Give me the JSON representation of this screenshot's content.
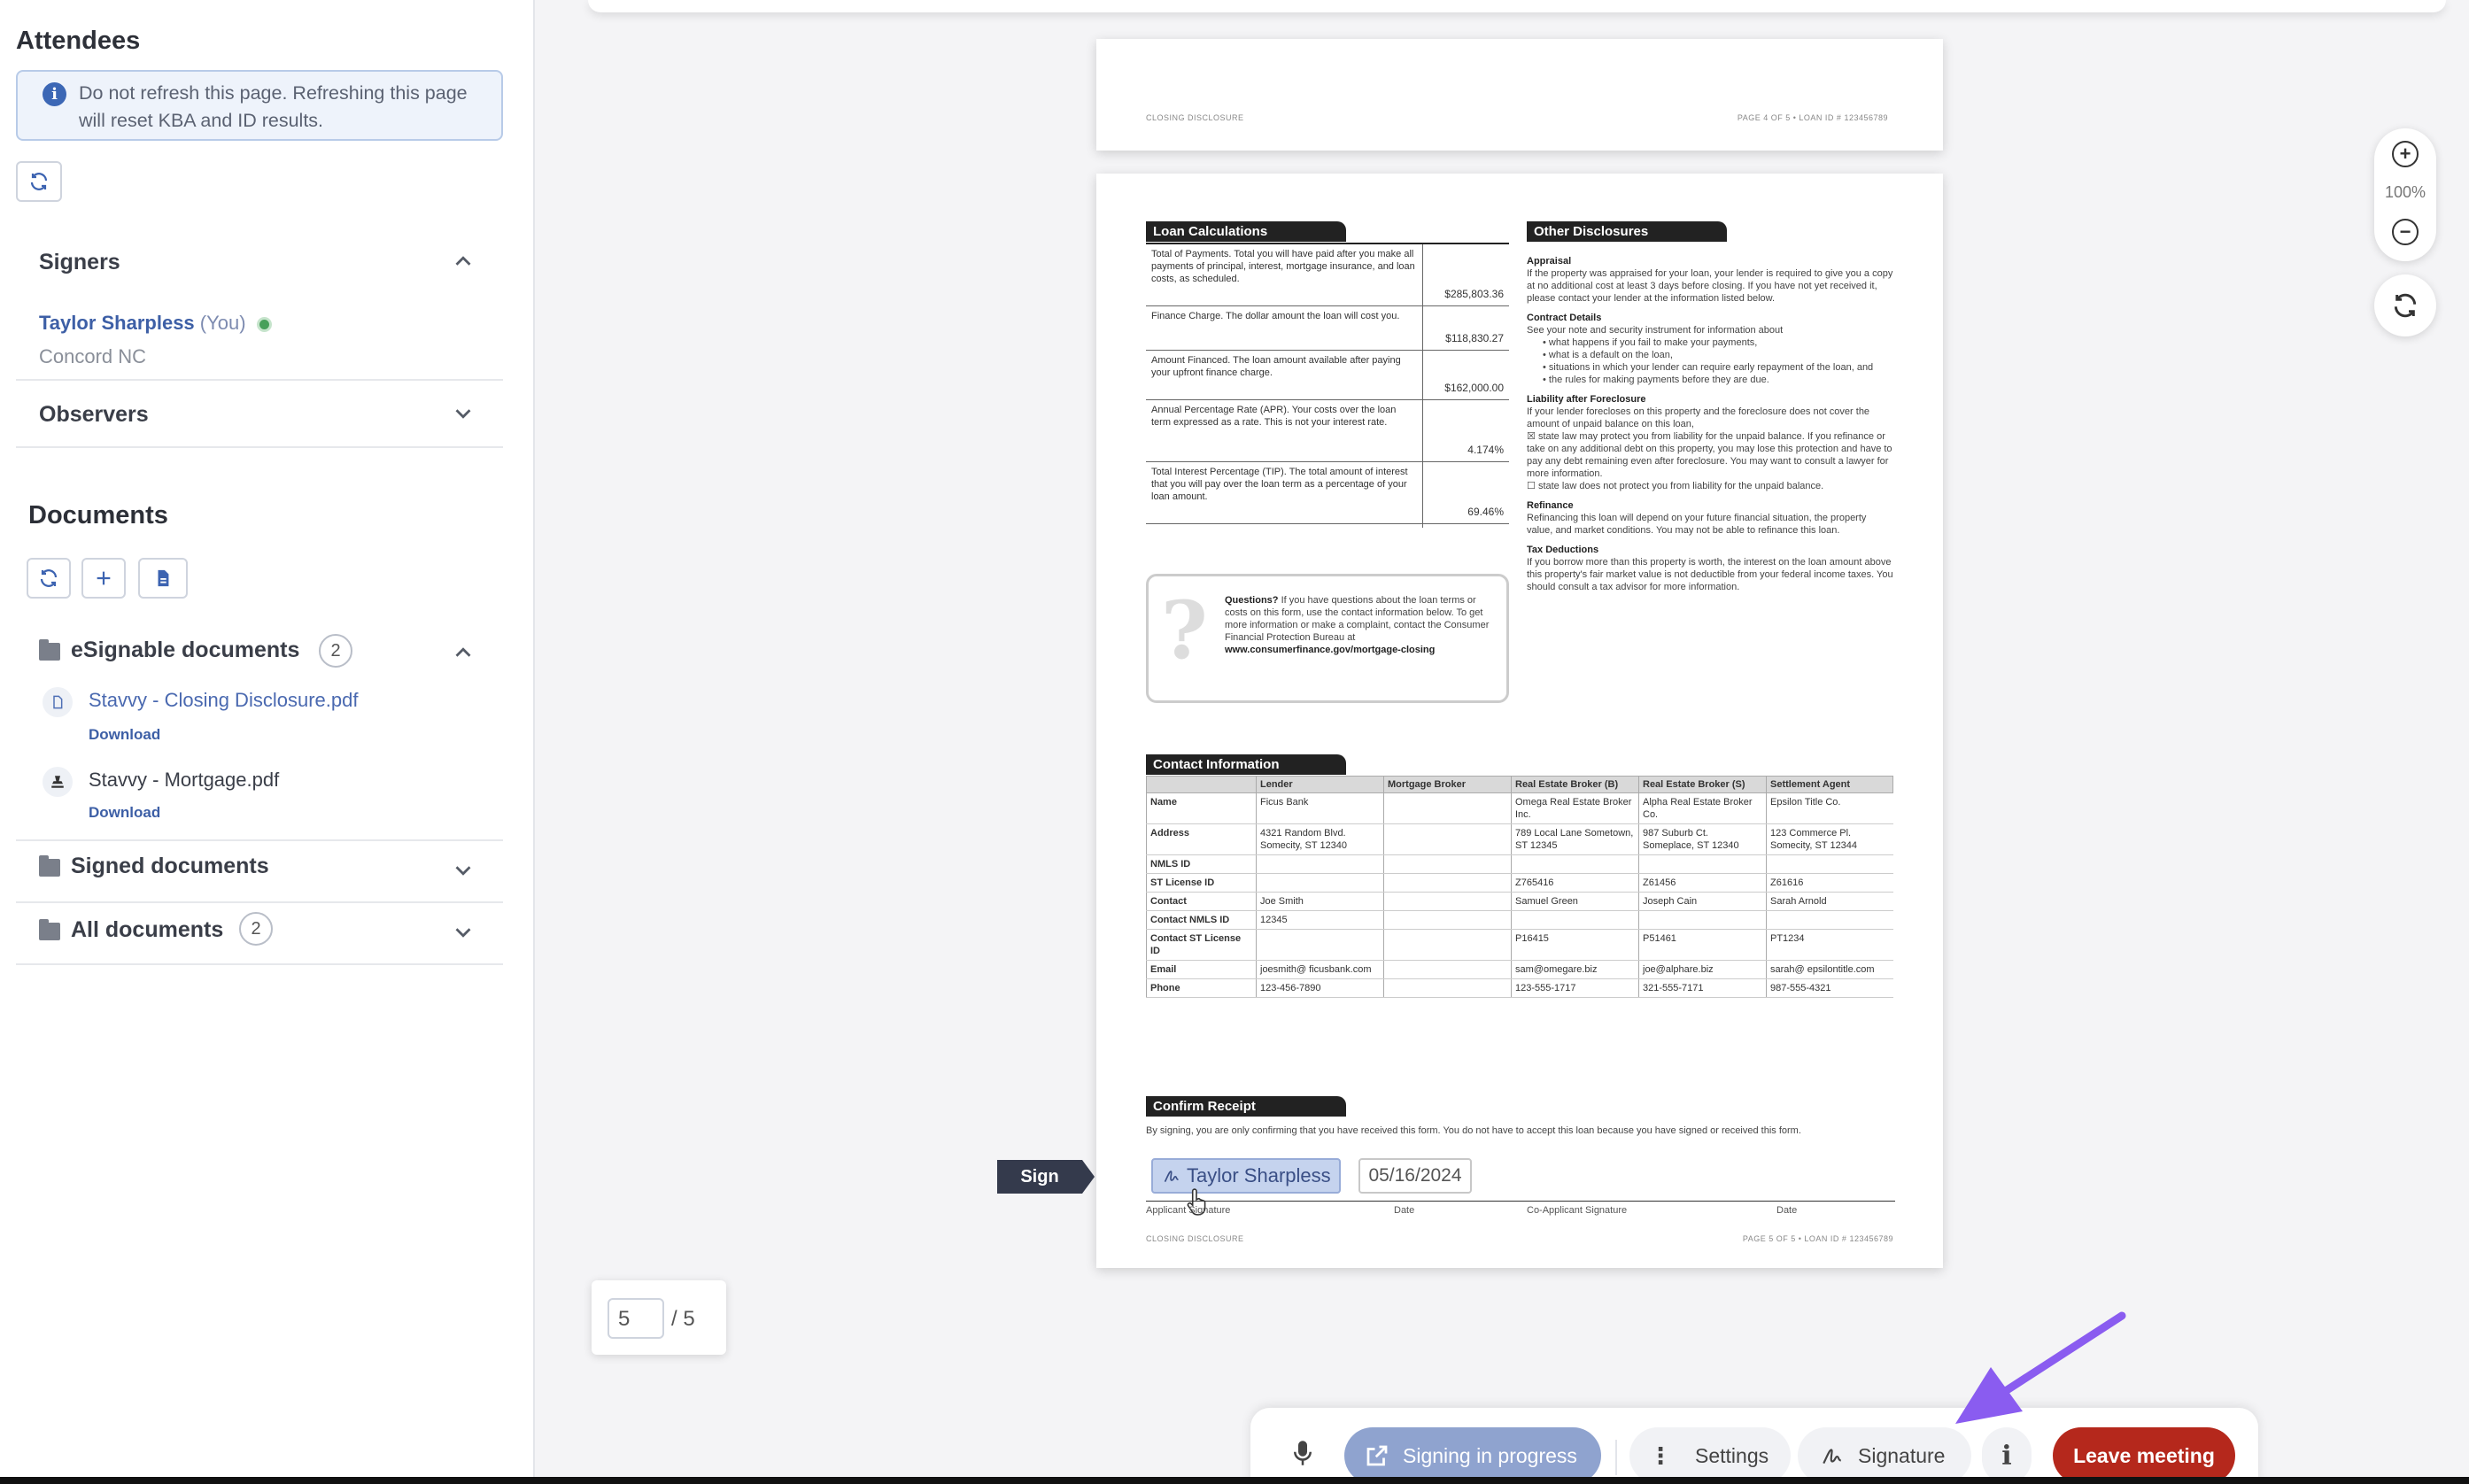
{
  "sidebar": {
    "attendees_title": "Attendees",
    "notice": "Do not refresh this page. Refreshing this page will reset KBA and ID results.",
    "signers": {
      "title": "Signers",
      "name": "Taylor Sharpless",
      "you_tag": "(You)",
      "location": "Concord NC"
    },
    "observers_title": "Observers",
    "documents_title": "Documents",
    "folders": {
      "esignable": {
        "label": "eSignable documents",
        "count": "2"
      },
      "signed": {
        "label": "Signed documents"
      },
      "all": {
        "label": "All documents",
        "count": "2"
      }
    },
    "docs": [
      {
        "name": "Stavvy - Closing Disclosure.pdf",
        "download": "Download"
      },
      {
        "name": "Stavvy - Mortgage.pdf",
        "download": "Download"
      }
    ]
  },
  "viewer": {
    "prev_page_footer_left": "CLOSING DISCLOSURE",
    "prev_page_footer_right": "PAGE 4 OF 5 • LOAN ID # 123456789",
    "page_footer_left": "CLOSING DISCLOSURE",
    "page_footer_right": "PAGE 5 OF 5 • LOAN ID # 123456789",
    "loan_calc_title": "Loan Calculations",
    "loan_calcs": [
      {
        "label": "Total of Payments. Total you will have paid after you make all payments of principal, interest, mortgage insurance, and loan costs, as scheduled.",
        "value": "$285,803.36"
      },
      {
        "label": "Finance Charge. The dollar amount the loan will cost you.",
        "value": "$118,830.27"
      },
      {
        "label": "Amount Financed. The loan amount available after paying your upfront finance charge.",
        "value": "$162,000.00"
      },
      {
        "label": "Annual Percentage Rate (APR). Your costs over the loan term expressed as a rate. This is not your interest rate.",
        "value": "4.174%"
      },
      {
        "label": "Total Interest Percentage (TIP). The total amount of interest that you will pay over the loan term as a percentage of your loan amount.",
        "value": "69.46%"
      }
    ],
    "questions_title": "Questions?",
    "questions_text": "If you have questions about the loan terms or costs on this form, use the contact information below. To get more information or make a complaint, contact the Consumer Financial Protection Bureau at",
    "questions_url": "www.consumerfinance.gov/mortgage-closing",
    "other_title": "Other Disclosures",
    "other": {
      "appraisal_h": "Appraisal",
      "appraisal": "If the property was appraised for your loan, your lender is required to give you a copy at no additional cost at least 3 days before closing. If you have not yet received it, please contact your lender at the information listed below.",
      "contract_h": "Contract Details",
      "contract": "See your note and security instrument for information about",
      "contract_items": [
        "• what happens if you fail to make your payments,",
        "• what is a default on the loan,",
        "• situations in which your lender can require early repayment of the loan, and",
        "• the rules for making payments before they are due."
      ],
      "liability_h": "Liability after Foreclosure",
      "liability": "If your lender forecloses on this property and the foreclosure does not cover the amount of unpaid balance on this loan,",
      "liability_opt1": "state law may protect you from liability for the unpaid balance. If you refinance or take on any additional debt on this property, you may lose this protection and have to pay any debt remaining even after foreclosure. You may want to consult a lawyer for more information.",
      "liability_opt2": "state law does not protect you from liability for the unpaid balance.",
      "refinance_h": "Refinance",
      "refinance": "Refinancing this loan will depend on your future financial situation, the property value, and market conditions. You may not be able to refinance this loan.",
      "tax_h": "Tax Deductions",
      "tax": "If you borrow more than this property is worth, the interest on the loan amount above this property's fair market value is not deductible from your federal income taxes. You should consult a tax advisor for more information."
    },
    "contact_title": "Contact Information",
    "contact_headers": [
      "",
      "Lender",
      "Mortgage Broker",
      "Real Estate Broker (B)",
      "Real Estate Broker (S)",
      "Settlement Agent"
    ],
    "contact_rows": [
      [
        "Name",
        "Ficus Bank",
        "",
        "Omega Real Estate Broker Inc.",
        "Alpha Real Estate Broker Co.",
        "Epsilon Title Co."
      ],
      [
        "Address",
        "4321 Random Blvd. Somecity, ST 12340",
        "",
        "789 Local Lane Sometown, ST 12345",
        "987 Suburb Ct. Someplace, ST 12340",
        "123 Commerce Pl. Somecity, ST 12344"
      ],
      [
        "NMLS ID",
        "",
        "",
        "",
        "",
        ""
      ],
      [
        "ST License ID",
        "",
        "",
        "Z765416",
        "Z61456",
        "Z61616"
      ],
      [
        "Contact",
        "Joe Smith",
        "",
        "Samuel Green",
        "Joseph Cain",
        "Sarah Arnold"
      ],
      [
        "Contact NMLS ID",
        "12345",
        "",
        "",
        "",
        ""
      ],
      [
        "Contact ST License ID",
        "",
        "",
        "P16415",
        "P51461",
        "PT1234"
      ],
      [
        "Email",
        "joesmith@ ficusbank.com",
        "",
        "sam@omegare.biz",
        "joe@alphare.biz",
        "sarah@ epsilontitle.com"
      ],
      [
        "Phone",
        "123-456-7890",
        "",
        "123-555-1717",
        "321-555-7171",
        "987-555-4321"
      ]
    ],
    "confirm_title": "Confirm Receipt",
    "confirm_text": "By signing, you are only confirming that you have received this form. You do not have to accept this loan because you have signed or received this form.",
    "sign_tag": "Sign",
    "sign_field": "Taylor Sharpless",
    "date_field": "05/16/2024",
    "sig_labels": [
      "Applicant Signature",
      "Date",
      "Co-Applicant Signature",
      "Date"
    ],
    "page_current": "5",
    "page_total": "/ 5",
    "zoom_level": "100%"
  },
  "bottombar": {
    "status": "Signing in progress",
    "settings": "Settings",
    "signature": "Signature",
    "leave": "Leave meeting"
  },
  "colors": {
    "brand_blue": "#3d5fa6",
    "leave_red": "#b5281c",
    "status_pill": "#8fa3cf",
    "arrow": "#8a5cf0"
  }
}
